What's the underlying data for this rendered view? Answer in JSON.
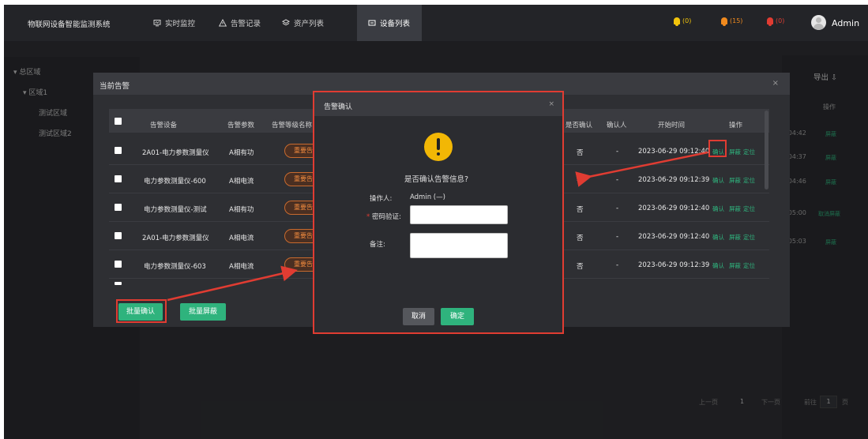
{
  "topbar": {
    "system_title": "物联网设备智能监测系统",
    "nav": [
      {
        "label": "实时监控",
        "icon": "monitor-icon",
        "active": false
      },
      {
        "label": "告警记录",
        "icon": "warning-icon",
        "active": false
      },
      {
        "label": "资产列表",
        "icon": "layers-icon",
        "active": false
      },
      {
        "label": "设备列表",
        "icon": "device-list-icon",
        "active": true
      }
    ],
    "bells": [
      {
        "count": "(0)",
        "color": "#f2c40c"
      },
      {
        "count": "(15)",
        "color": "#f08a1e"
      },
      {
        "count": "(0)",
        "color": "#e03c32"
      }
    ],
    "user": "Admin"
  },
  "sidebar": {
    "items": [
      {
        "label": "总区域",
        "level": 0
      },
      {
        "label": "区域1",
        "level": 1
      },
      {
        "label": "测试区域",
        "level": 2
      },
      {
        "label": "测试区域2",
        "level": 2
      }
    ]
  },
  "right_panel": {
    "export_label": "导出",
    "header_left": "间",
    "header_right": "操作",
    "rows": [
      {
        "time": "7:04:42",
        "op": "屏蔽"
      },
      {
        "time": "7:04:37",
        "op": "屏蔽"
      },
      {
        "time": "7:04:46",
        "op": "屏蔽"
      },
      {
        "time": "7:05:00",
        "op": "取消屏蔽"
      },
      {
        "time": "7:05:03",
        "op": "屏蔽"
      }
    ],
    "pager": {
      "prev": "上一页",
      "page": "1",
      "next": "下一页",
      "goto": "前往",
      "goto_value": "1",
      "unit": "页"
    }
  },
  "alarm_dialog": {
    "title": "当前告警",
    "close": "×",
    "columns": [
      "告警设备",
      "告警参数",
      "告警等级名称",
      "是否确认",
      "确认人",
      "开始时间",
      "操作"
    ],
    "rows": [
      {
        "device": "2A01-电力参数测量仪",
        "param": "A相有功",
        "level": "重要告警",
        "confirmed": "否",
        "confirmer": "-",
        "start": "2023-06-29 09:12:40"
      },
      {
        "device": "电力参数测量仪-600",
        "param": "A相电流",
        "level": "重要告警",
        "confirmed": "否",
        "confirmer": "-",
        "start": "2023-06-29 09:12:39"
      },
      {
        "device": "电力参数测量仪-测试",
        "param": "A相有功",
        "level": "重要告警",
        "confirmed": "否",
        "confirmer": "-",
        "start": "2023-06-29 09:12:40"
      },
      {
        "device": "2A01-电力参数测量仪",
        "param": "A相电流",
        "level": "重要告警",
        "confirmed": "否",
        "confirmer": "-",
        "start": "2023-06-29 09:12:40"
      },
      {
        "device": "电力参数测量仪-603",
        "param": "A相电流",
        "level": "重要告警",
        "confirmed": "否",
        "confirmer": "-",
        "start": "2023-06-29 09:12:39"
      }
    ],
    "ops": {
      "confirm": "确认",
      "mask": "屏蔽",
      "locate": "定位"
    },
    "batch_confirm": "批量确认",
    "batch_mask": "批量屏蔽"
  },
  "confirm_dialog": {
    "title": "告警确认",
    "close": "×",
    "question": "是否确认告警信息?",
    "operator_label": "操作人:",
    "operator_value": "Admin (—)",
    "required_mark": "*",
    "password_label": "密码验证:",
    "remark_label": "备注:",
    "cancel": "取消",
    "ok": "确定"
  }
}
